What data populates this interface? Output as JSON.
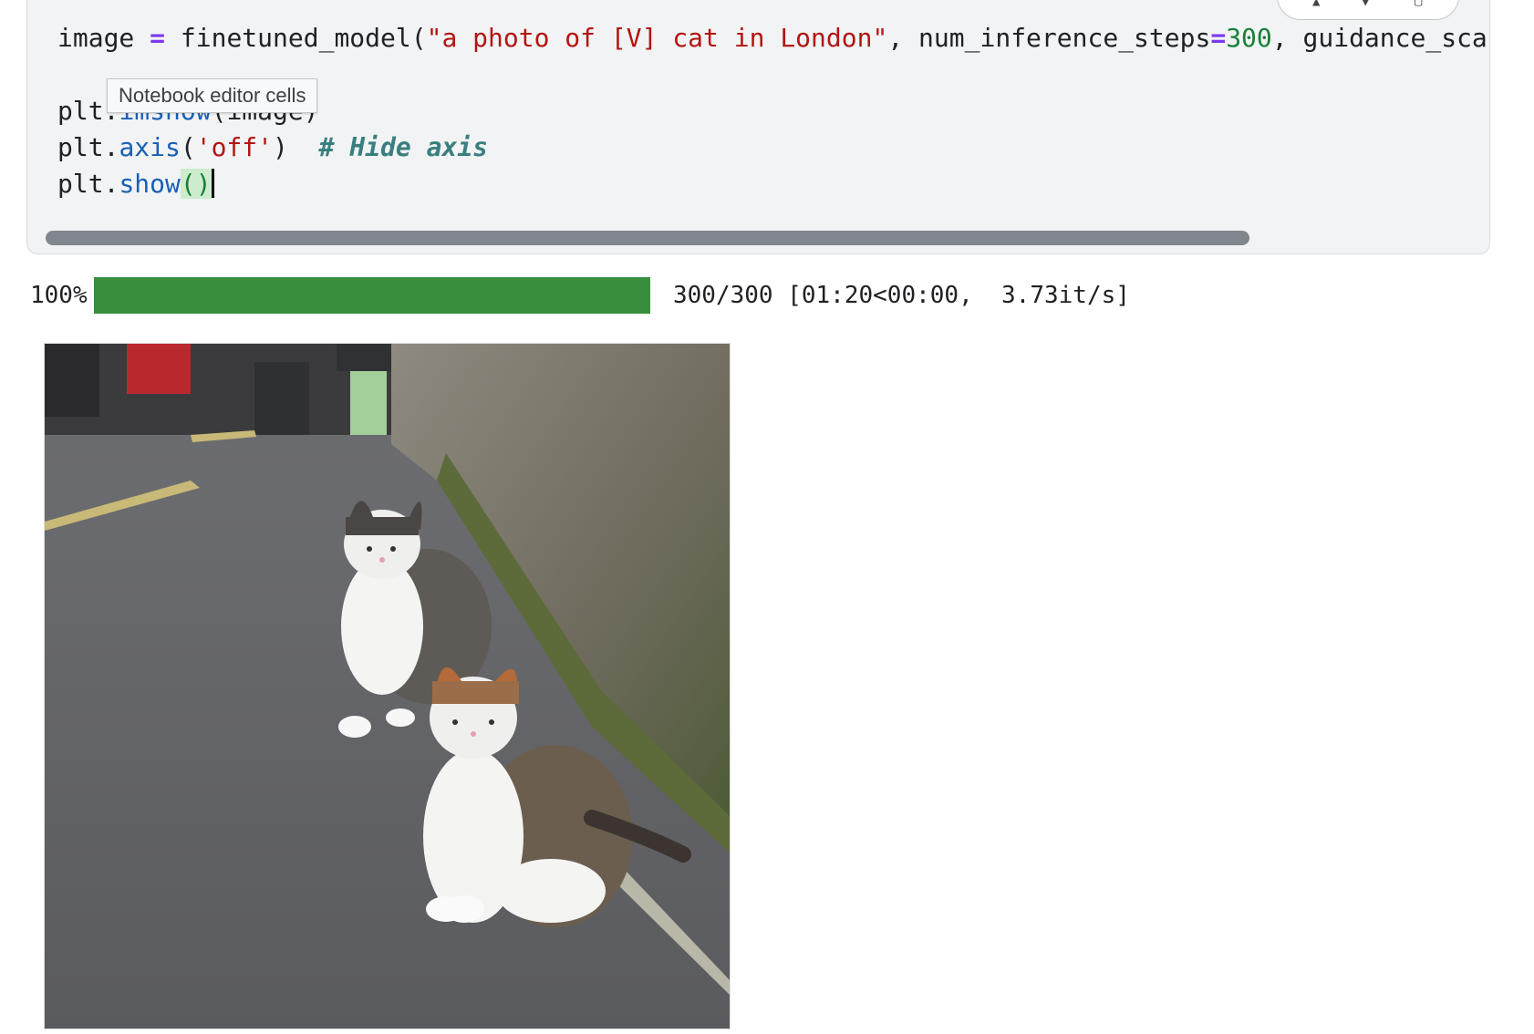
{
  "code_cell": {
    "lines": [
      [
        {
          "t": "image ",
          "c": ""
        },
        {
          "t": "=",
          "c": "kw-op"
        },
        {
          "t": " finetuned_model(",
          "c": ""
        },
        {
          "t": "\"a photo of [V] cat in London\"",
          "c": "str"
        },
        {
          "t": ", num_inference_steps",
          "c": ""
        },
        {
          "t": "=",
          "c": "kw-op"
        },
        {
          "t": "300",
          "c": "num"
        },
        {
          "t": ", guidance_sca",
          "c": ""
        }
      ],
      [],
      [
        {
          "t": "plt.",
          "c": ""
        },
        {
          "t": "imshow",
          "c": "fn"
        },
        {
          "t": "(image)",
          "c": ""
        }
      ],
      [
        {
          "t": "plt.",
          "c": ""
        },
        {
          "t": "axis",
          "c": "fn"
        },
        {
          "t": "(",
          "c": ""
        },
        {
          "t": "'off'",
          "c": "str"
        },
        {
          "t": ")  ",
          "c": ""
        },
        {
          "t": "# Hide axis",
          "c": "cmt"
        }
      ],
      [
        {
          "t": "plt.",
          "c": ""
        },
        {
          "t": "show",
          "c": "fn"
        },
        {
          "t": "()",
          "c": "bracket"
        }
      ]
    ],
    "tooltip": "Notebook editor cells"
  },
  "progress": {
    "percent_label": "100%",
    "fraction": 1.0,
    "stats": "300/300 [01:20<00:00,  3.73it/s]",
    "fill_color": "#388e3c"
  },
  "output_image": {
    "alt": "a photo of [V] cat in London"
  },
  "toolbar": {
    "icons": [
      "arrow-up-icon",
      "arrow-down-icon",
      "copy-icon"
    ]
  }
}
